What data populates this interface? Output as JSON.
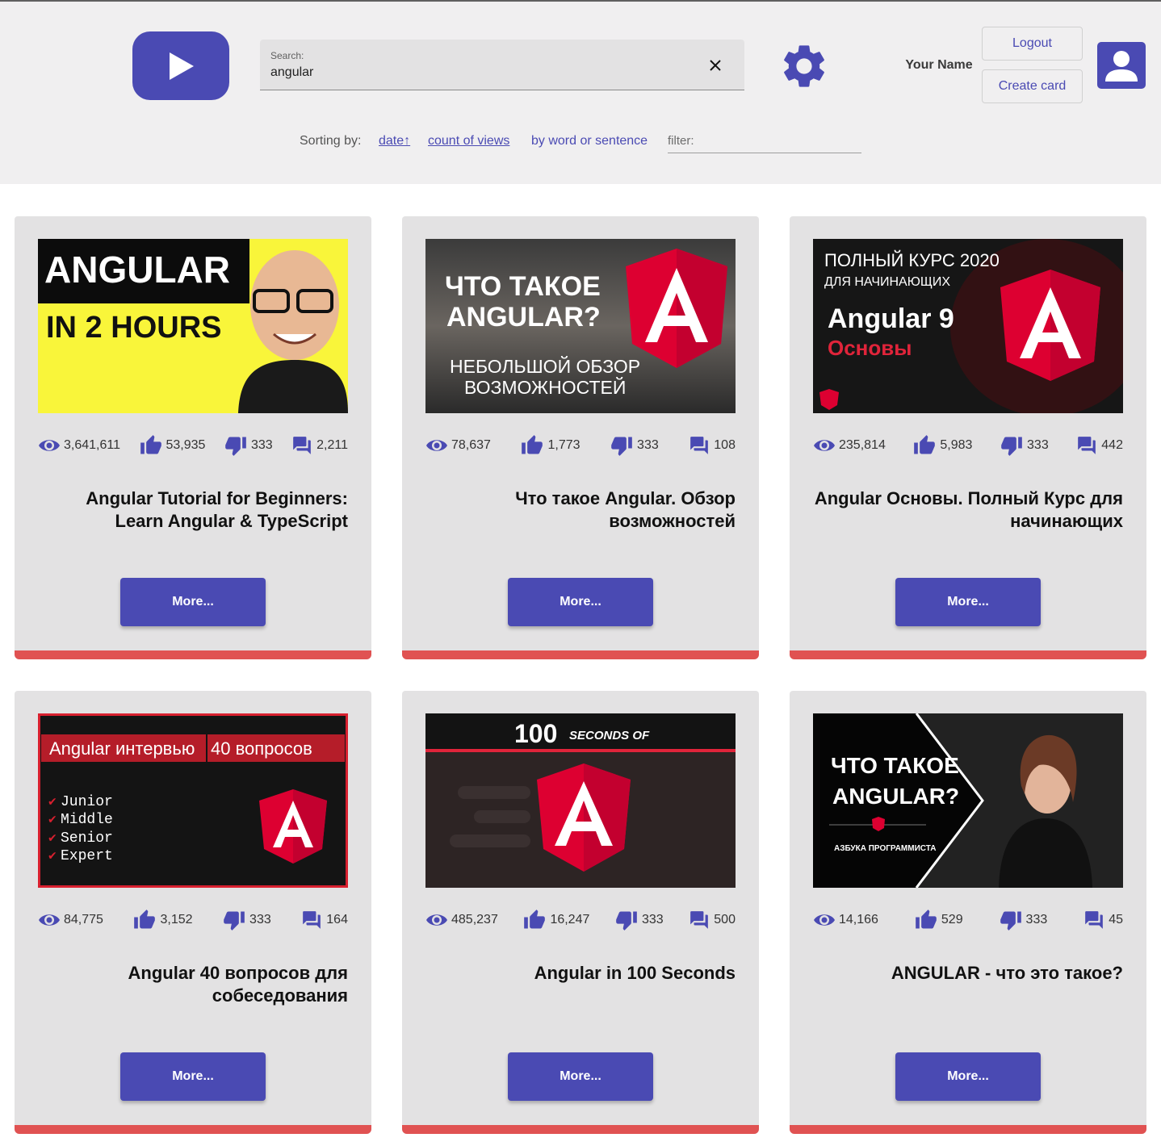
{
  "header": {
    "search_label": "Search:",
    "search_value": "angular",
    "user_name": "Your Name",
    "logout_label": "Logout",
    "create_card_label": "Create card",
    "accent_color": "#4a4ab3"
  },
  "sorting": {
    "label": "Sorting by:",
    "date_label": "date↑",
    "views_label": "count of views",
    "word_label": "by word or sentence",
    "filter_placeholder": "filter:"
  },
  "cards": [
    {
      "thumb_lines": [
        "ANGULAR",
        "IN 2 HOURS"
      ],
      "views": "3,641,611",
      "likes": "53,935",
      "dislikes": "333",
      "comments": "2,211",
      "title": "Angular Tutorial for Beginners: Learn Angular & TypeScript",
      "more_label": "More..."
    },
    {
      "thumb_lines": [
        "ЧТО ТАКОЕ",
        "ANGULAR?",
        "НЕБОЛЬШОЙ ОБЗОР",
        "ВОЗМОЖНОСТЕЙ"
      ],
      "views": "78,637",
      "likes": "1,773",
      "dislikes": "333",
      "comments": "108",
      "title": "Что такое Angular. Обзор возможностей",
      "more_label": "More..."
    },
    {
      "thumb_lines": [
        "ПОЛНЫЙ КУРС 2020",
        "ДЛЯ НАЧИНАЮЩИХ",
        "Angular 9",
        "Основы"
      ],
      "views": "235,814",
      "likes": "5,983",
      "dislikes": "333",
      "comments": "442",
      "title": "Angular Основы. Полный Курс для начинающих",
      "more_label": "More..."
    },
    {
      "thumb_lines": [
        "Angular интервью",
        "40 вопросов",
        "Junior",
        "Middle",
        "Senior",
        "Expert"
      ],
      "views": "84,775",
      "likes": "3,152",
      "dislikes": "333",
      "comments": "164",
      "title": "Angular 40 вопросов для собеседования",
      "more_label": "More..."
    },
    {
      "thumb_lines": [
        "100",
        "SECONDS OF"
      ],
      "views": "485,237",
      "likes": "16,247",
      "dislikes": "333",
      "comments": "500",
      "title": "Angular in 100 Seconds",
      "more_label": "More..."
    },
    {
      "thumb_lines": [
        "ЧТО ТАКОЕ",
        "ANGULAR?",
        "АЗБУКА ПРОГРАММИСТА"
      ],
      "views": "14,166",
      "likes": "529",
      "dislikes": "333",
      "comments": "45",
      "title": "ANGULAR - что это такое?",
      "more_label": "More..."
    }
  ]
}
